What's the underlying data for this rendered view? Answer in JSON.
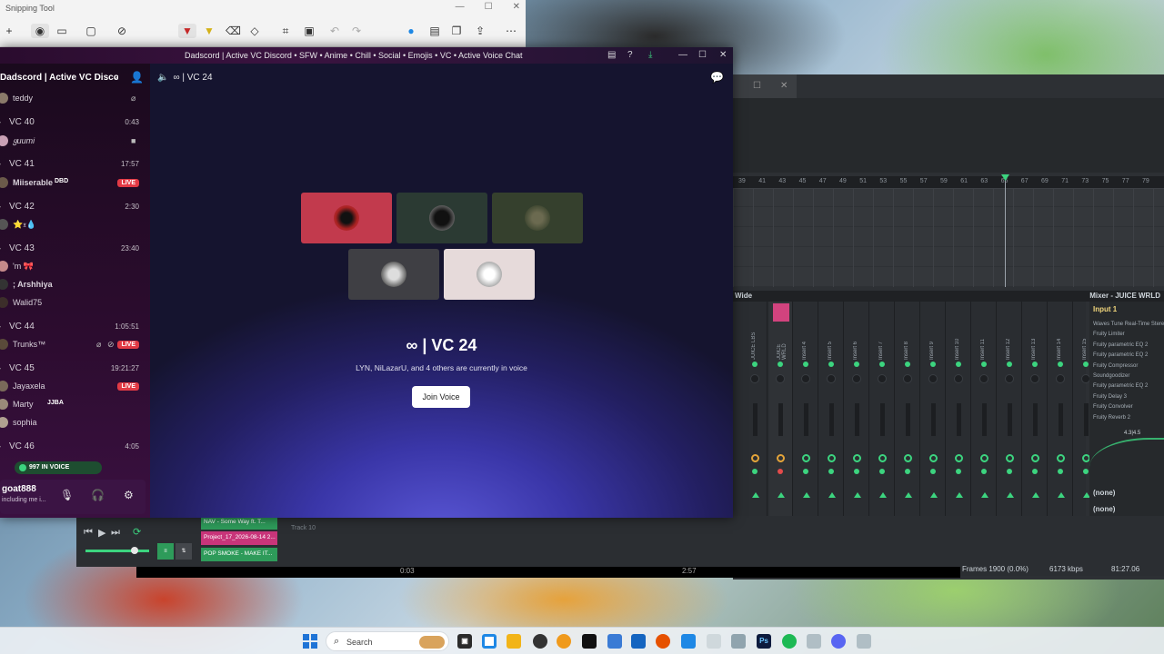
{
  "snipping_tool": {
    "title": "Snipping Tool",
    "plus": "+",
    "more": "⋯"
  },
  "discord": {
    "window_title": "Dadscord | Active VC Discord • SFW • Anime • Chill • Social • Emojis • VC • Active Voice Chat",
    "server_name": "Dadscord | Active VC Disco...",
    "channels": [
      {
        "name": "VC 40",
        "time": "0:43",
        "members": [
          {
            "name": "ყuumi"
          }
        ]
      },
      {
        "name": "VC 41",
        "time": "17:57",
        "members": [
          {
            "name": "Miiserable",
            "tag": "DBD",
            "live": "LIVE"
          }
        ]
      },
      {
        "name": "VC 42",
        "time": "2:30",
        "members": [
          {
            "name": "⭐𝔵💧"
          }
        ]
      },
      {
        "name": "VC 43",
        "time": "23:40",
        "members": [
          {
            "name": "'m 🎀"
          },
          {
            "name": "; Arshhiya"
          },
          {
            "name": "Walid75"
          }
        ]
      },
      {
        "name": "VC 44",
        "time": "1:05:51",
        "members": [
          {
            "name": "Trunks™",
            "live": "LIVE"
          }
        ]
      },
      {
        "name": "VC 45",
        "time": "19:21:27",
        "live": "LIVE",
        "members": [
          {
            "name": "Jayaxela"
          },
          {
            "name": "Marty",
            "tag": "JJBA"
          },
          {
            "name": "sophia"
          }
        ]
      },
      {
        "name": "VC 46",
        "time": "4:05",
        "members": []
      }
    ],
    "top_member": "teddy",
    "voice_pill": "997 IN VOICE",
    "user": {
      "name": "goat888",
      "status": "including me i..."
    },
    "vc_header": "∞ | VC 24",
    "vc_title": "∞ | VC 24",
    "vc_sub": "LYN, NiLazarU, and 4 others are currently in voice",
    "join_label": "Join Voice"
  },
  "daw": {
    "ruler": [
      "39",
      "41",
      "43",
      "45",
      "47",
      "49",
      "51",
      "53",
      "55",
      "57",
      "59",
      "61",
      "63",
      "65",
      "67",
      "69",
      "71",
      "73",
      "75",
      "77",
      "79"
    ],
    "mixer_left": "Wide",
    "mixer_title": "Mixer - JUICE WRLD",
    "strips": [
      "JUICE LBS",
      "JUICE WRLD",
      "Insert 4",
      "Insert 5",
      "Insert 6",
      "Insert 7",
      "Insert 8",
      "Insert 9",
      "Insert 10",
      "Insert 11",
      "Insert 12",
      "Insert 13",
      "Insert 14",
      "Insert 15"
    ],
    "fx_input": "Input 1",
    "fx_chain": [
      "Waves Tune Real-Time Stereo",
      "Fruity Limiter",
      "Fruity parametric EQ 2",
      "Fruity parametric EQ 2",
      "Fruity Compressor",
      "Soundgoodizer",
      "Fruity parametric EQ 2",
      "Fruity Delay 3",
      "Fruity Convolver",
      "Fruity Reverb 2"
    ],
    "fx_value": "4.3|4.5",
    "fx_none_1": "(none)",
    "fx_none_2": "(none)",
    "playlist_buttons": [
      "NAV - Some Way ft. T...",
      "Project_17_2026-08-14 2...",
      "POP SMOKE - MAKE IT..."
    ],
    "track_label": "Track 10",
    "time_start": "0:03",
    "time_end": "2:57",
    "status_frames": "Frames 1900 (0.0%)",
    "status_kbps": "6173 kbps",
    "status_time": "81:27.06"
  },
  "taskbar": {
    "search_text": "Search"
  },
  "colors": {
    "live": "#e23a45",
    "accent_green": "#3cd47f",
    "tile_red": "#c23a4d",
    "tile_dark": "#2b3a33",
    "tile_olive": "#35402d",
    "tile_grey": "#3f3f44",
    "tile_light": "#e6dada"
  }
}
